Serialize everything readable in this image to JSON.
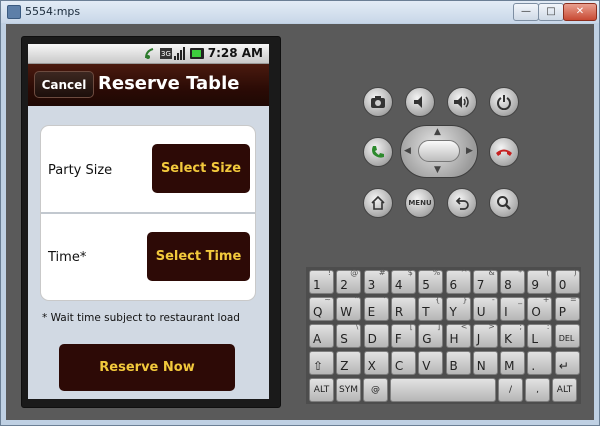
{
  "window": {
    "title": "5554:mps"
  },
  "status_bar": {
    "time": "7:28 AM"
  },
  "action_bar": {
    "cancel_label": "Cancel",
    "title": "Reserve Table"
  },
  "form": {
    "party_size_label": "Party Size",
    "party_size_button": "Select Size",
    "time_label": "Time*",
    "time_button": "Select Time",
    "note": "* Wait time subject to restaurant load",
    "reserve_button": "Reserve Now"
  },
  "controls": {
    "menu_label": "MENU"
  },
  "keyboard": {
    "row1": [
      {
        "main": "1",
        "alt": "!"
      },
      {
        "main": "2",
        "alt": "@"
      },
      {
        "main": "3",
        "alt": "#"
      },
      {
        "main": "4",
        "alt": "$"
      },
      {
        "main": "5",
        "alt": "%"
      },
      {
        "main": "6",
        "alt": "^"
      },
      {
        "main": "7",
        "alt": "&"
      },
      {
        "main": "8",
        "alt": "*"
      },
      {
        "main": "9",
        "alt": "("
      },
      {
        "main": "0",
        "alt": ")"
      }
    ],
    "row2": [
      {
        "main": "Q",
        "alt": "~"
      },
      {
        "main": "W",
        "alt": "\""
      },
      {
        "main": "E",
        "alt": "'"
      },
      {
        "main": "R",
        "alt": "`"
      },
      {
        "main": "T",
        "alt": "{"
      },
      {
        "main": "Y",
        "alt": "}"
      },
      {
        "main": "U",
        "alt": "-"
      },
      {
        "main": "I",
        "alt": "_"
      },
      {
        "main": "O",
        "alt": "+"
      },
      {
        "main": "P",
        "alt": "="
      }
    ],
    "row3": [
      {
        "main": "A",
        "alt": ""
      },
      {
        "main": "S",
        "alt": "\\"
      },
      {
        "main": "D",
        "alt": ""
      },
      {
        "main": "F",
        "alt": "["
      },
      {
        "main": "G",
        "alt": "]"
      },
      {
        "main": "H",
        "alt": "<"
      },
      {
        "main": "J",
        "alt": ">"
      },
      {
        "main": "K",
        "alt": ";"
      },
      {
        "main": "L",
        "alt": ":"
      },
      {
        "main": "DEL",
        "alt": ""
      }
    ],
    "row4": [
      {
        "main": "⇧",
        "alt": ""
      },
      {
        "main": "Z",
        "alt": ""
      },
      {
        "main": "X",
        "alt": ""
      },
      {
        "main": "C",
        "alt": ""
      },
      {
        "main": "V",
        "alt": ""
      },
      {
        "main": "B",
        "alt": ""
      },
      {
        "main": "N",
        "alt": ""
      },
      {
        "main": "M",
        "alt": ""
      },
      {
        "main": ".",
        "alt": ""
      },
      {
        "main": "↵",
        "alt": ""
      }
    ],
    "row5": {
      "alt_left": "ALT",
      "sym": "SYM",
      "at": "@",
      "space": "",
      "slash": "/",
      "comma": ",",
      "alt_right": "ALT"
    }
  },
  "colors": {
    "accent_text": "#f2c93c",
    "button_bg": "#2d0a06",
    "action_bar_bg": "#2b0b05"
  }
}
